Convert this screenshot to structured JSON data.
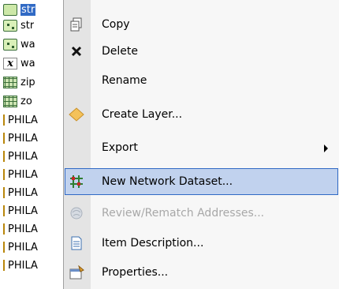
{
  "tree": {
    "items": [
      {
        "label": "str",
        "icon": "line-feature-icon",
        "selected": true
      },
      {
        "label": "str",
        "icon": "point-feature-icon"
      },
      {
        "label": "wa",
        "icon": "point-feature-icon"
      },
      {
        "label": "wa",
        "icon": "table-icon"
      },
      {
        "label": "zip",
        "icon": "raster-icon"
      },
      {
        "label": "zo",
        "icon": "raster-icon"
      },
      {
        "label": "PHILA",
        "icon": "folder-bracket"
      },
      {
        "label": "PHILA",
        "icon": "folder-bracket"
      },
      {
        "label": "PHILA",
        "icon": "folder-bracket"
      },
      {
        "label": "PHILA",
        "icon": "folder-bracket"
      },
      {
        "label": "PHILA",
        "icon": "folder-bracket"
      },
      {
        "label": "PHILA",
        "icon": "folder-bracket"
      },
      {
        "label": "PHILA",
        "icon": "folder-bracket"
      }
    ]
  },
  "menu": {
    "items": [
      {
        "label": "Copy",
        "icon": "copy-icon"
      },
      {
        "label": "Delete",
        "icon": "delete-icon"
      },
      {
        "label": "Rename",
        "icon": ""
      },
      {
        "label": "Create Layer...",
        "icon": "create-layer-icon"
      },
      {
        "label": "Export",
        "icon": "",
        "submenu": true
      },
      {
        "label": "New Network Dataset...",
        "icon": "network-dataset-icon",
        "highlighted": true
      },
      {
        "label": "Review/Rematch Addresses...",
        "icon": "geocode-icon",
        "disabled": true
      },
      {
        "label": "Item Description...",
        "icon": "item-description-icon"
      },
      {
        "label": "Properties...",
        "icon": "properties-icon"
      }
    ]
  },
  "colors": {
    "highlight_fill": "#c1d2ee",
    "highlight_border": "#316ac5",
    "disabled_text": "#a8a8a8",
    "gutter": "#e4e4e4"
  }
}
